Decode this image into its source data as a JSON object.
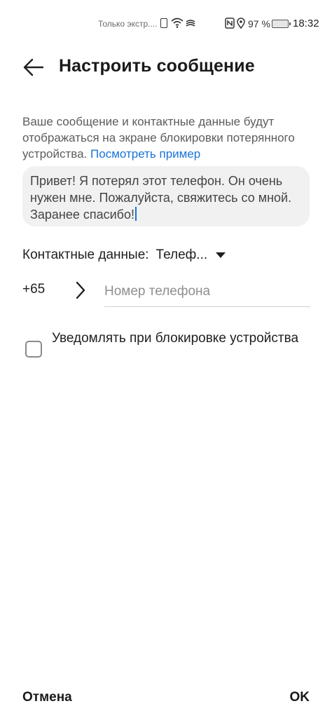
{
  "status_bar": {
    "carrier": "Только экстр....",
    "battery_percent": "97 %",
    "time": "18:32"
  },
  "header": {
    "title": "Настроить сообщение"
  },
  "info": {
    "text": "Ваше сообщение и контактные данные будут отображаться на экране блокировки потерянного устройства.",
    "link": "Посмотреть пример"
  },
  "message": {
    "value": "Привет! Я потерял этот телефон. Он очень нужен мне. Пожалуйста, свяжитесь со мной. Заранее спасибо!"
  },
  "contact": {
    "label": "Контактные данные:",
    "type": "Телеф..."
  },
  "phone": {
    "country_code": "+65",
    "placeholder": "Номер телефона"
  },
  "notify": {
    "label": "Уведомлять при блокировке устройства",
    "checked": false
  },
  "footer": {
    "cancel_label": "Отмена",
    "ok_label": "OK"
  },
  "icons": {
    "back": "arrow-left-icon",
    "dropdown": "triangle-down-icon",
    "country_select": "chevron-right-icon"
  },
  "colors": {
    "link": "#1a73d9",
    "message_bg": "#f1f1f1"
  }
}
